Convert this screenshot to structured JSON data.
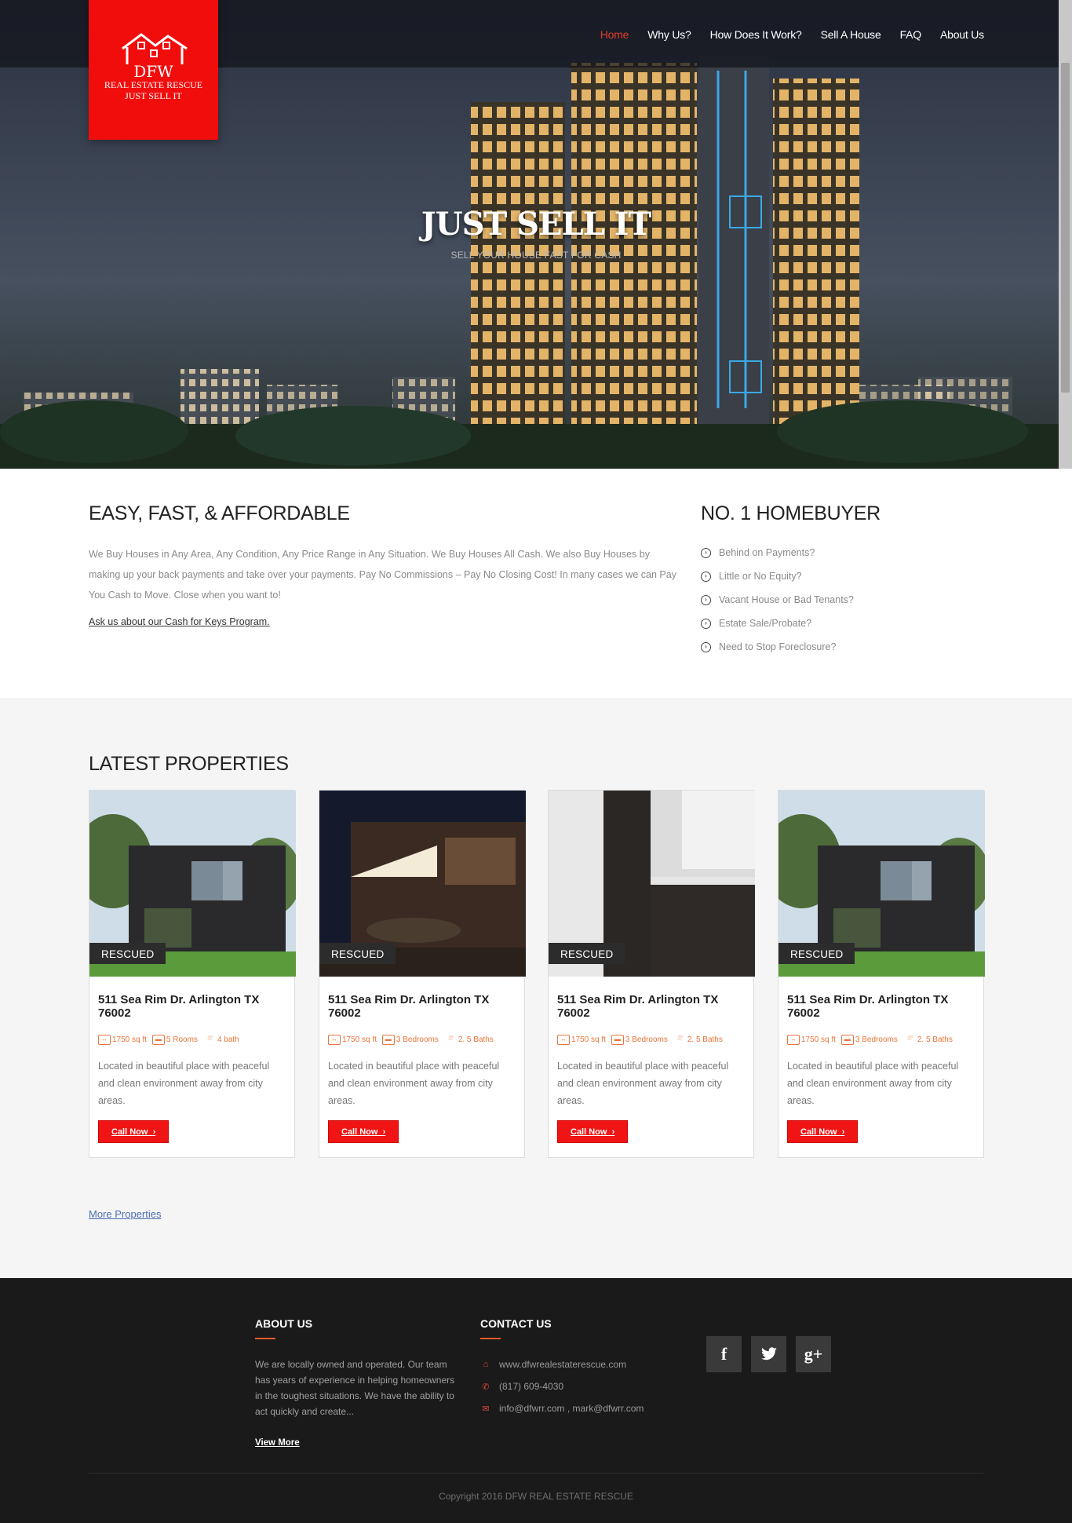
{
  "brand": {
    "logo_name": "DFW",
    "logo_line1": "REAL ESTATE RESCUE",
    "logo_line2": "JUST SELL IT",
    "accent": "#f20d0d"
  },
  "nav": {
    "items": [
      {
        "label": "Home",
        "active": true
      },
      {
        "label": "Why Us?"
      },
      {
        "label": "How Does It Work?"
      },
      {
        "label": "Sell A House"
      },
      {
        "label": "FAQ"
      },
      {
        "label": "About Us"
      }
    ]
  },
  "hero": {
    "title": "JUST SELL IT",
    "subtitle": "SELL YOUR HOUSE FAST FOR CASH"
  },
  "intro": {
    "heading": "EASY, FAST, & AFFORDABLE",
    "text": "We Buy Houses in Any Area, Any Condition, Any Price Range in Any Situation. We Buy Houses All Cash. We also Buy Houses by making up your back payments and take over your payments. Pay No Commissions – Pay No Closing Cost! In many cases we can Pay You Cash to Move. Close when you want to!",
    "link": "Ask us about our Cash for Keys Program."
  },
  "homebuyer": {
    "heading": "NO. 1 HOMEBUYER",
    "items": [
      "Behind on Payments?",
      "Little or No Equity?",
      "Vacant House or Bad Tenants?",
      "Estate Sale/Probate?",
      "Need to Stop Foreclosure?"
    ]
  },
  "properties": {
    "heading": "LATEST PROPERTIES",
    "more": "More Properties",
    "cards": [
      {
        "badge": "RESCUED",
        "title": "511 Sea Rim Dr. Arlington TX 76002",
        "area": "1750 sq ft",
        "rooms": "5 Rooms",
        "baths": "4 bath",
        "desc": "Located in beautiful place with peaceful and clean environment away from city areas.",
        "button": "Call Now"
      },
      {
        "badge": "RESCUED",
        "title": "511 Sea Rim Dr. Arlington TX 76002",
        "area": "1750 sq ft",
        "rooms": "3 Bedrooms",
        "baths": "2. 5 Baths",
        "desc": "Located in beautiful place with peaceful and clean environment away from city areas.",
        "button": "Call Now"
      },
      {
        "badge": "RESCUED",
        "title": "511 Sea Rim Dr. Arlington TX 76002",
        "area": "1750 sq ft",
        "rooms": "3 Bedrooms",
        "baths": "2. 5 Baths",
        "desc": "Located in beautiful place with peaceful and clean environment away from city areas.",
        "button": "Call Now"
      },
      {
        "badge": "RESCUED",
        "title": "511 Sea Rim Dr. Arlington TX 76002",
        "area": "1750 sq ft",
        "rooms": "3 Bedrooms",
        "baths": "2. 5 Baths",
        "desc": "Located in beautiful place with peaceful and clean environment away from city areas.",
        "button": "Call Now"
      }
    ]
  },
  "footer": {
    "about_title": "ABOUT US",
    "about_text": "We are locally owned and operated. Our team has years of experience in helping homeowners in the toughest situations. We have the ability to act quickly and create...",
    "view_more": "View More",
    "contact_title": "CONTACT US",
    "website": "www.dfwrealestaterescue.com",
    "phone": "(817) 609-4030",
    "email": "info@dfwrr.com , mark@dfwrr.com",
    "copyright": "Copyright 2016 DFW REAL ESTATE RESCUE"
  }
}
